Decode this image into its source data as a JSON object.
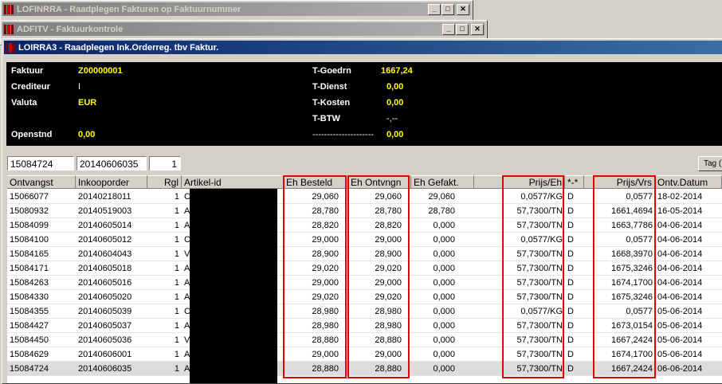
{
  "windows": [
    {
      "title": "LOFINRRA - Raadplegen Fakturen op Faktuurnummer"
    },
    {
      "title": "ADFITV - Faktuurkontrole"
    },
    {
      "title": "LOIRRA3 - Raadplegen Ink.Orderreg. tbv Faktur."
    }
  ],
  "title_buttons": {
    "minimize": "_",
    "maximize": "□",
    "close": "✕"
  },
  "header": {
    "faktuur_label": "Faktuur",
    "faktuur_value": "Z00000001",
    "crediteur_label": "Crediteur",
    "crediteur_value": "I",
    "valuta_label": "Valuta",
    "valuta_value": "EUR",
    "openstnd_label": "Openstnd",
    "openstnd_value": "0,00",
    "tgoedrn_label": "T-Goedrn",
    "tgoedrn_value": "1667,24",
    "tdienst_label": "T-Dienst",
    "tdienst_value": "0,00",
    "tkosten_label": "T-Kosten",
    "tkosten_value": "0,00",
    "tbtw_label": "T-BTW",
    "tbtw_value": "-,--",
    "dashes_label": "---------------------",
    "dashes_value": "0,00"
  },
  "inputs": {
    "ontvangst": "15084724",
    "inkooporder": "20140606035",
    "regel": "1"
  },
  "tag_button": "Tag (",
  "columns": [
    "Ontvangst",
    "Inkooporder",
    "Rgl",
    "Artikel-id",
    "Eh Besteld",
    "Eh Ontvngn",
    "Eh Gefakt.",
    "Prijs/Eh",
    "*-*",
    "Prijs/Vrs",
    "Ontv.Datum"
  ],
  "rows": [
    [
      "15066077",
      "20140218011",
      "1",
      "C",
      "29,060",
      "29,060",
      "29,060",
      "0,0577/KG",
      "D",
      "0,0577",
      "18-02-2014"
    ],
    [
      "15080932",
      "20140519003",
      "1",
      "A",
      "28,780",
      "28,780",
      "28,780",
      "57,7300/TN",
      "D",
      "1661,4694",
      "16-05-2014"
    ],
    [
      "15084099",
      "20140605014",
      "1",
      "A",
      "28,820",
      "28,820",
      "0,000",
      "57,7300/TN",
      "D",
      "1663,7786",
      "04-06-2014"
    ],
    [
      "15084100",
      "20140605012",
      "1",
      "C",
      "29,000",
      "29,000",
      "0,000",
      "0,0577/KG",
      "D",
      "0,0577",
      "04-06-2014"
    ],
    [
      "15084165",
      "20140604043",
      "1",
      "V",
      "28,900",
      "28,900",
      "0,000",
      "57,7300/TN",
      "D",
      "1668,3970",
      "04-06-2014"
    ],
    [
      "15084171",
      "20140605018",
      "1",
      "A",
      "29,020",
      "29,020",
      "0,000",
      "57,7300/TN",
      "D",
      "1675,3246",
      "04-06-2014"
    ],
    [
      "15084263",
      "20140605016",
      "1",
      "A",
      "29,000",
      "29,000",
      "0,000",
      "57,7300/TN",
      "D",
      "1674,1700",
      "04-06-2014"
    ],
    [
      "15084330",
      "20140605020",
      "1",
      "A",
      "29,020",
      "29,020",
      "0,000",
      "57,7300/TN",
      "D",
      "1675,3246",
      "04-06-2014"
    ],
    [
      "15084355",
      "20140605039",
      "1",
      "C",
      "28,980",
      "28,980",
      "0,000",
      "0,0577/KG",
      "D",
      "0,0577",
      "05-06-2014"
    ],
    [
      "15084427",
      "20140605037",
      "1",
      "A",
      "28,980",
      "28,980",
      "0,000",
      "57,7300/TN",
      "D",
      "1673,0154",
      "05-06-2014"
    ],
    [
      "15084450",
      "20140605036",
      "1",
      "V",
      "28,880",
      "28,880",
      "0,000",
      "57,7300/TN",
      "D",
      "1667,2424",
      "05-06-2014"
    ],
    [
      "15084629",
      "20140606001",
      "1",
      "A",
      "29,000",
      "29,000",
      "0,000",
      "57,7300/TN",
      "D",
      "1674,1700",
      "05-06-2014"
    ],
    [
      "15084724",
      "20140606035",
      "1",
      "A",
      "28,880",
      "28,880",
      "0,000",
      "57,7300/TN",
      "D",
      "1667,2424",
      "06-06-2014"
    ]
  ],
  "colors": {
    "header_bg": "#000000",
    "header_label": "#ffffff",
    "header_value": "#ffff00",
    "highlight": "#e00000",
    "active_title": "#0a246a"
  }
}
